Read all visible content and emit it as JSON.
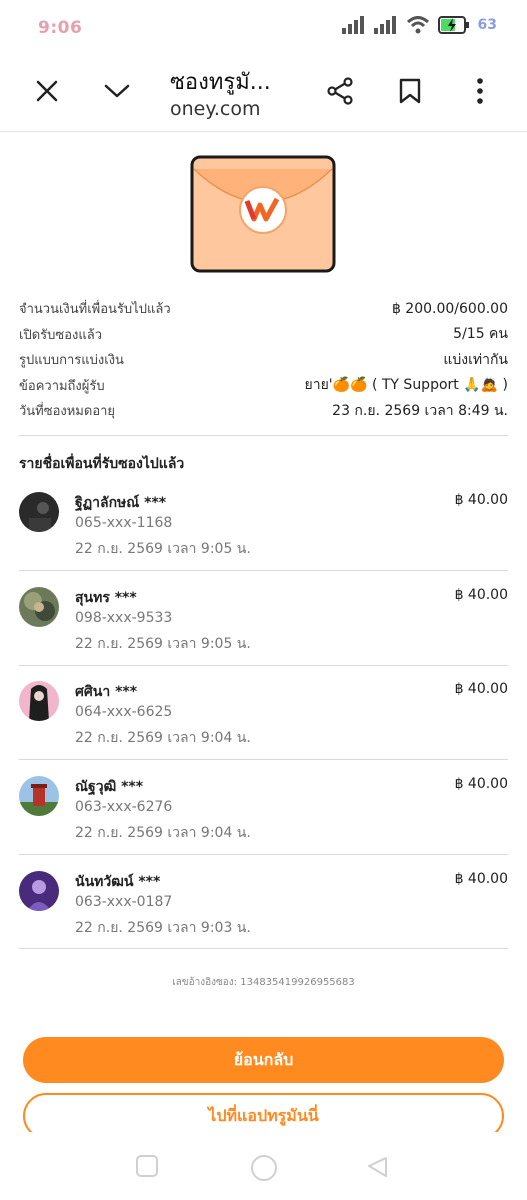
{
  "status": {
    "time": "9:06",
    "battery": "63"
  },
  "browser": {
    "title": "ซองทรูมั...",
    "url": "oney.com"
  },
  "info": [
    {
      "label": "จำนวนเงินที่เพื่อนรับไปแล้ว",
      "value": "฿ 200.00/600.00"
    },
    {
      "label": "เปิดรับซองแล้ว",
      "value": "5/15 คน"
    },
    {
      "label": "รูปแบบการแบ่งเงิน",
      "value": "แบ่งเท่ากัน"
    },
    {
      "label": "ข้อความถึงผู้รับ",
      "value": "ยาย'🍊🍊 ( TY Support 🙏🙇 )"
    },
    {
      "label": "วันที่ซองหมดอายุ",
      "value": "23 ก.ย. 2569 เวลา 8:49 น."
    }
  ],
  "friends_title": "รายชื่อเพื่อนที่รับซองไปแล้ว",
  "friends": [
    {
      "name": "ฐิฏาลักษณ์ ***",
      "phone": "065-xxx-1168",
      "date": "22 ก.ย. 2569 เวลา 9:05 น.",
      "amount": "฿ 40.00"
    },
    {
      "name": "สุนทร ***",
      "phone": "098-xxx-9533",
      "date": "22 ก.ย. 2569 เวลา 9:05 น.",
      "amount": "฿ 40.00"
    },
    {
      "name": "ศศินา ***",
      "phone": "064-xxx-6625",
      "date": "22 ก.ย. 2569 เวลา 9:04 น.",
      "amount": "฿ 40.00"
    },
    {
      "name": "ณัฐวุฒิ ***",
      "phone": "063-xxx-6276",
      "date": "22 ก.ย. 2569 เวลา 9:04 น.",
      "amount": "฿ 40.00"
    },
    {
      "name": "นันทวัฒน์ ***",
      "phone": "063-xxx-0187",
      "date": "22 ก.ย. 2569 เวลา 9:03 น.",
      "amount": "฿ 40.00"
    }
  ],
  "reference": "เลขอ้างอิงซอง: 134835419926955683",
  "buttons": {
    "back": "ย้อนกลับ",
    "open_app": "ไปที่แอปทรูมันนี่"
  },
  "colors": {
    "accent": "#ff8a1f",
    "envelope": "#ffc79d"
  },
  "icons": [
    "close-icon",
    "chevron-down-icon",
    "share-icon",
    "bookmark-icon",
    "more-vert-icon",
    "signal-icon",
    "wifi-icon",
    "battery-icon",
    "nav-square-icon",
    "nav-circle-icon",
    "nav-back-icon"
  ]
}
